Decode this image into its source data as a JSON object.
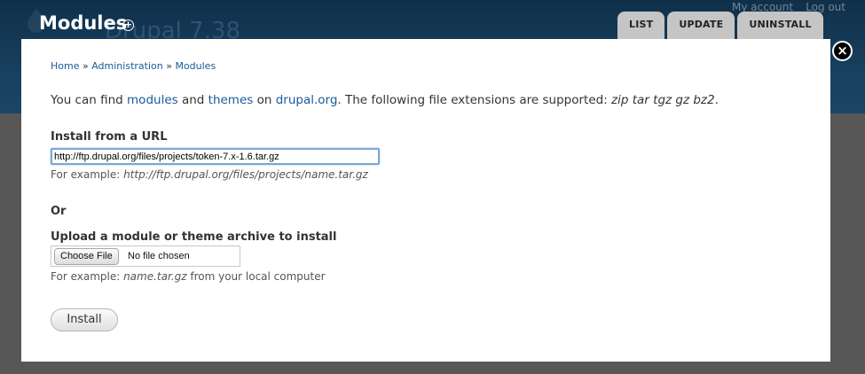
{
  "header": {
    "page_title": "Modules",
    "site_name": "Drupal 7.38",
    "secondary_links": [
      "My account",
      "Log out"
    ],
    "tabs": [
      {
        "label": "LIST"
      },
      {
        "label": "UPDATE"
      },
      {
        "label": "UNINSTALL"
      }
    ]
  },
  "overlay": {
    "close_symbol": "×",
    "breadcrumb": {
      "items": [
        "Home",
        "Administration",
        "Modules"
      ],
      "separator": "»"
    },
    "intro": {
      "prefix": "You can find ",
      "modules_link": "modules",
      "and": " and ",
      "themes_link": "themes",
      "on": " on ",
      "drupal_link": "drupal.org",
      "suffix": ". The following file extensions are supported: ",
      "extensions": "zip tar tgz gz bz2",
      "end": "."
    },
    "url_field": {
      "label": "Install from a URL",
      "value": "http://ftp.drupal.org/files/projects/token-7.x-1.6.tar.gz",
      "desc_prefix": "For example: ",
      "desc_example": "http://ftp.drupal.org/files/projects/name.tar.gz"
    },
    "or_label": "Or",
    "upload_field": {
      "label": "Upload a module or theme archive to install",
      "button_label": "Choose File",
      "status": "No file chosen",
      "desc_prefix": "For example: ",
      "desc_example": "name.tar.gz",
      "desc_suffix": " from your local computer"
    },
    "install_label": "Install"
  },
  "colors": {
    "link": "#1a5a9a",
    "header_bg": "#173f5e",
    "tab_bg": "#c5c5c5"
  }
}
